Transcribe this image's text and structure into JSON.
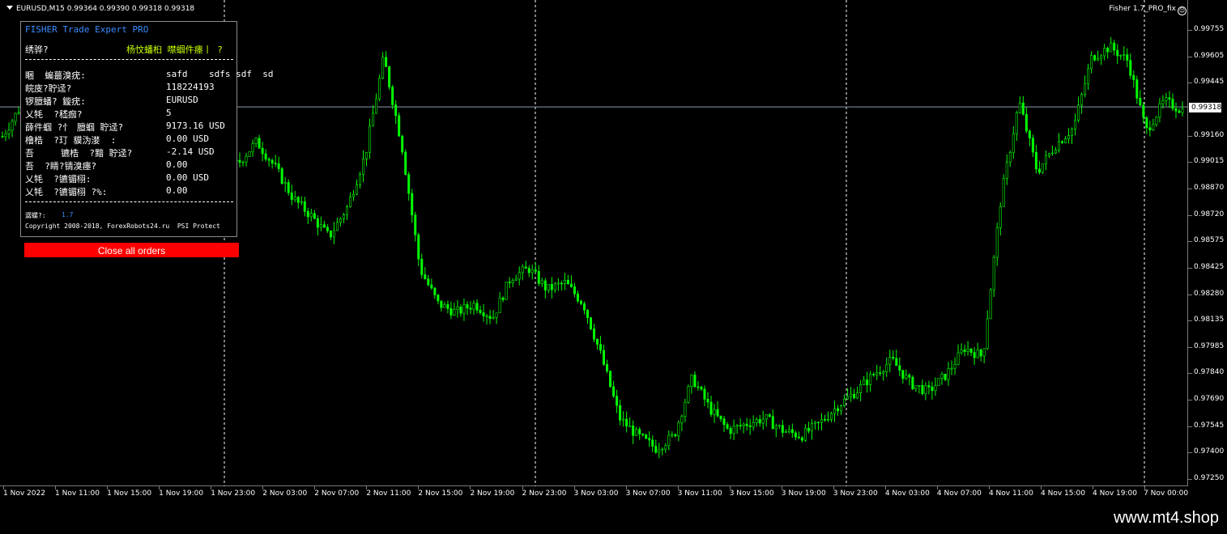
{
  "chart": {
    "symbol_bar": "EURUSD,M15  0.99364 0.99390 0.99318 0.99318",
    "indicator_label": "Fisher 1.7_PRO_fix",
    "indicator_icon": "smile-icon",
    "current_price": "0.99318",
    "price_ticks": [
      "0.99755",
      "0.99605",
      "0.99445",
      "0.99318",
      "0.99160",
      "0.99015",
      "0.98870",
      "0.98720",
      "0.98575",
      "0.98425",
      "0.98280",
      "0.98135",
      "0.97985",
      "0.97840",
      "0.97690",
      "0.97545",
      "0.97400",
      "0.97250"
    ],
    "time_labels": [
      "1 Nov 2022",
      "1 Nov 11:00",
      "1 Nov 15:00",
      "1 Nov 19:00",
      "1 Nov 23:00",
      "2 Nov 03:00",
      "2 Nov 07:00",
      "2 Nov 11:00",
      "2 Nov 15:00",
      "2 Nov 19:00",
      "2 Nov 23:00",
      "3 Nov 03:00",
      "3 Nov 07:00",
      "3 Nov 11:00",
      "3 Nov 15:00",
      "3 Nov 19:00",
      "3 Nov 23:00",
      "4 Nov 03:00",
      "4 Nov 07:00",
      "4 Nov 11:00",
      "4 Nov 15:00",
      "4 Nov 19:00",
      "7 Nov 00:00"
    ],
    "candle_color": "#00ff00",
    "grid_color": "#ffffff",
    "price_line_color": "#8a9bb0",
    "price_path_values": [
      0.9915,
      0.9932,
      0.9905,
      0.9888,
      0.9878,
      0.9889,
      0.99,
      0.9885,
      0.9878,
      0.9892,
      0.9908,
      0.9918,
      0.9895,
      0.99,
      0.9912,
      0.9898,
      0.988,
      0.987,
      0.9858,
      0.9875,
      0.9905,
      0.996,
      0.991,
      0.984,
      0.982,
      0.9815,
      0.982,
      0.9812,
      0.9835,
      0.984,
      0.9828,
      0.9832,
      0.982,
      0.979,
      0.9755,
      0.9745,
      0.9738,
      0.9745,
      0.9778,
      0.976,
      0.9748,
      0.9752,
      0.9755,
      0.9748,
      0.9745,
      0.9752,
      0.9762,
      0.977,
      0.978,
      0.9788,
      0.9775,
      0.977,
      0.978,
      0.9795,
      0.979,
      0.988,
      0.9935,
      0.9895,
      0.991,
      0.992,
      0.996,
      0.9966,
      0.9958,
      0.9918,
      0.9935,
      0.993
    ]
  },
  "panel": {
    "title": "FISHER Trade Expert PRO",
    "header_left": "绣骅?",
    "header_right": "杨忟蟠桕 噤蝈件瘗丨 ?",
    "rows": [
      {
        "label": "睏  蝙蕞溴疣:",
        "value": "safd    sdfs sdf  sd"
      },
      {
        "label": "皖庋?聍迳?",
        "value": "118224193"
      },
      {
        "label": "锣膻蟠? 鏇疣:",
        "value": "EURUSD"
      },
      {
        "label": "乂牦  ?嵇痂?",
        "value": "5"
      },
      {
        "label": "薛件蝈 ?忄 膻蝈 聍迳?",
        "value": "9173.16 USD"
      },
      {
        "label": "橹梏  ?玎 貘沩漤  :",
        "value": "0.00 USD"
      },
      {
        "label": "吾     镳梏  ?黯 聍迳?",
        "value": "-2.14 USD"
      },
      {
        "label": "吾  ?睛?锖溴瘗?",
        "value": "0.00"
      },
      {
        "label": "乂牦  ?镳镅栩:",
        "value": "0.00 USD"
      },
      {
        "label": "乂牦  ?镳镅栩 ?%:",
        "value": "0.00"
      }
    ],
    "version_label": "潺螺?:",
    "version_value": "1.7",
    "copyright": "Copyright 2008-2018, ForexRobots24.ru  PSI Protect"
  },
  "close_button": {
    "label": "Close all orders"
  },
  "watermark": "www.mt4.shop"
}
